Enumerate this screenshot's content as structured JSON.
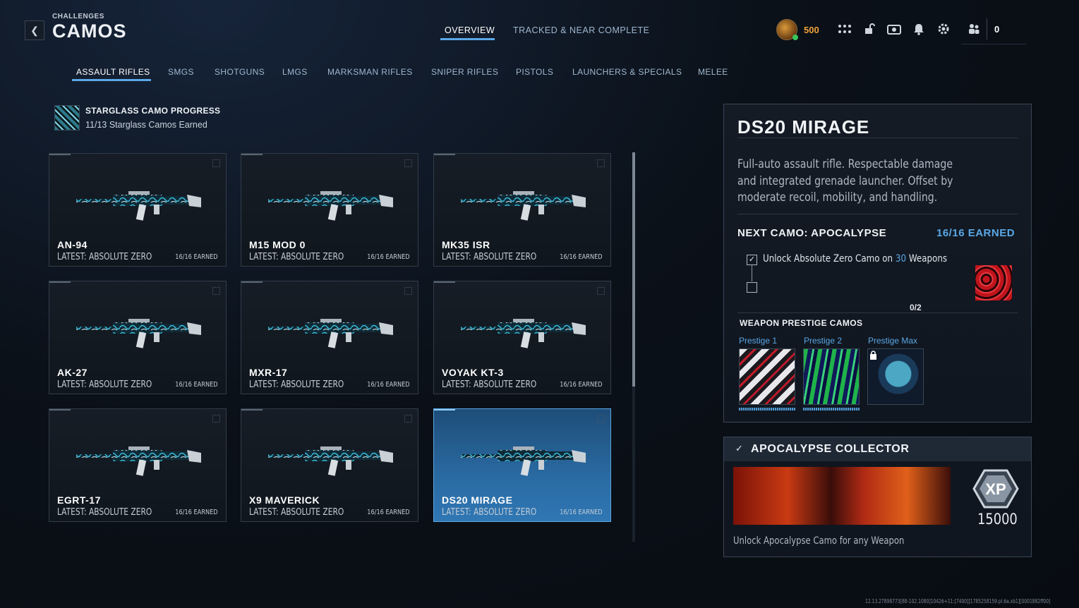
{
  "header": {
    "breadcrumb": "CHALLENGES",
    "title": "CAMOS",
    "tabs": [
      {
        "label": "OVERVIEW",
        "active": true
      },
      {
        "label": "TRACKED & NEAR COMPLETE",
        "active": false
      }
    ],
    "currency": "500",
    "friends_count": "0"
  },
  "categories": [
    {
      "label": "ASSAULT RIFLES",
      "active": true
    },
    {
      "label": "SMGS"
    },
    {
      "label": "SHOTGUNS"
    },
    {
      "label": "LMGS"
    },
    {
      "label": "MARKSMAN RIFLES"
    },
    {
      "label": "SNIPER RIFLES"
    },
    {
      "label": "PISTOLS"
    },
    {
      "label": "LAUNCHERS & SPECIALS"
    },
    {
      "label": "MELEE"
    }
  ],
  "starglass": {
    "title": "STARGLASS CAMO PROGRESS",
    "subtitle": "11/13 Starglass Camos Earned"
  },
  "weapons": [
    {
      "name": "AN-94",
      "latest": "LATEST: ABSOLUTE ZERO",
      "earned": "16/16 EARNED"
    },
    {
      "name": "M15 MOD 0",
      "latest": "LATEST: ABSOLUTE ZERO",
      "earned": "16/16 EARNED"
    },
    {
      "name": "MK35 ISR",
      "latest": "LATEST: ABSOLUTE ZERO",
      "earned": "16/16 EARNED"
    },
    {
      "name": "AK-27",
      "latest": "LATEST: ABSOLUTE ZERO",
      "earned": "16/16 EARNED"
    },
    {
      "name": "MXR-17",
      "latest": "LATEST: ABSOLUTE ZERO",
      "earned": "16/16 EARNED"
    },
    {
      "name": "VOYAK KT-3",
      "latest": "LATEST: ABSOLUTE ZERO",
      "earned": "16/16 EARNED"
    },
    {
      "name": "EGRT-17",
      "latest": "LATEST: ABSOLUTE ZERO",
      "earned": "16/16 EARNED"
    },
    {
      "name": "X9 MAVERICK",
      "latest": "LATEST: ABSOLUTE ZERO",
      "earned": "16/16 EARNED"
    },
    {
      "name": "DS20 MIRAGE",
      "latest": "LATEST: ABSOLUTE ZERO",
      "earned": "16/16 EARNED",
      "selected": true
    }
  ],
  "detail": {
    "title": "DS20 MIRAGE",
    "description": "Full-auto assault rifle. Respectable damage and integrated grenade launcher. Offset by moderate recoil, mobility, and handling.",
    "next_camo": "NEXT CAMO: APOCALYPSE",
    "earned": "16/16 EARNED",
    "requirement_prefix": "Unlock Absolute Zero Camo on ",
    "requirement_count": "30",
    "requirement_suffix": " Weapons",
    "progress": "0/2",
    "prestige_heading": "WEAPON PRESTIGE CAMOS",
    "prestige": [
      {
        "label": "Prestige 1"
      },
      {
        "label": "Prestige 2"
      },
      {
        "label": "Prestige Max",
        "locked": true
      }
    ]
  },
  "collector": {
    "title": "APOCALYPSE COLLECTOR",
    "xp_label": "XP",
    "xp_amount": "15000",
    "description": "Unlock Apocalypse Camo for any Weapon"
  },
  "build_id": "12.13.27898773[88-102.1080]10426+11:[7400][1785258159.pl.6a.xb1][0001882ff00]",
  "colors": {
    "accent": "#5aa7e6",
    "currency": "#f0a23a",
    "selected_card": "#2a6aa2"
  }
}
